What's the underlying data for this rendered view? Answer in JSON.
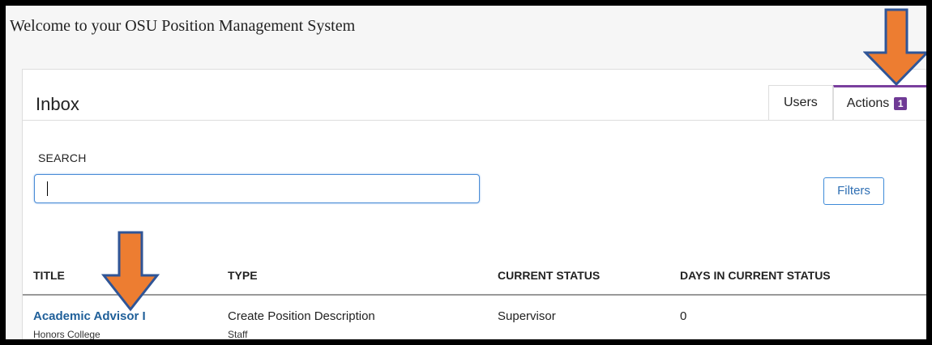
{
  "header": {
    "welcome": "Welcome to your OSU Position Management System"
  },
  "inbox": {
    "title": "Inbox",
    "tabs": [
      {
        "label": "Users"
      },
      {
        "label": "Actions",
        "badge": "1"
      }
    ],
    "search": {
      "label": "SEARCH",
      "value": "",
      "placeholder": ""
    },
    "filters_label": "Filters"
  },
  "table": {
    "columns": [
      "TITLE",
      "TYPE",
      "CURRENT STATUS",
      "DAYS IN CURRENT STATUS"
    ],
    "rows": [
      {
        "title": "Academic Advisor I",
        "department": "Honors College",
        "type": "Create Position Description",
        "subtype": "Staff",
        "status": "Supervisor",
        "days": "0"
      }
    ]
  },
  "colors": {
    "accent_link": "#1f5f99",
    "tab_accent": "#7a3f9e",
    "arrow_fill": "#ed7d31",
    "arrow_outline": "#2f5597"
  },
  "annotations": [
    {
      "icon": "down-arrow-icon"
    },
    {
      "icon": "down-arrow-icon"
    }
  ]
}
